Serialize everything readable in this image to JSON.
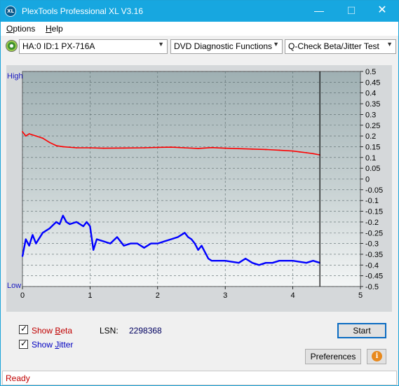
{
  "window": {
    "title": "PlexTools Professional XL V3.16",
    "app_icon_text": "XL",
    "minimize_glyph": "—",
    "maximize_glyph": "☐",
    "close_glyph": "✕"
  },
  "menu": {
    "options_first": "O",
    "options_rest": "ptions",
    "help_first": "H",
    "help_rest": "elp"
  },
  "toolbar": {
    "drive": "HA:0 ID:1  PX-716A",
    "function": "DVD Diagnostic Functions",
    "test": "Q-Check Beta/Jitter Test",
    "icons": [
      "drive-disc-icon",
      "chevron-down-icon"
    ]
  },
  "chart_data": {
    "type": "line",
    "left_axis_labels": {
      "high": "High",
      "low": "Low"
    },
    "right_axis_ticks": [
      "0.5",
      "0.45",
      "0.4",
      "0.35",
      "0.3",
      "0.25",
      "0.2",
      "0.15",
      "0.1",
      "0.05",
      "0",
      "-0.05",
      "-0.1",
      "-0.15",
      "-0.2",
      "-0.25",
      "-0.3",
      "-0.35",
      "-0.4",
      "-0.45",
      "-0.5"
    ],
    "y_range": [
      -0.5,
      0.5
    ],
    "x_ticks": [
      "0",
      "1",
      "2",
      "3",
      "4",
      "5"
    ],
    "x_range": [
      0,
      5
    ],
    "end_marker_x": 4.4,
    "grid": true,
    "series": [
      {
        "color": "#ff0000",
        "points": [
          [
            0.0,
            0.22
          ],
          [
            0.05,
            0.2
          ],
          [
            0.1,
            0.21
          ],
          [
            0.2,
            0.2
          ],
          [
            0.3,
            0.19
          ],
          [
            0.4,
            0.17
          ],
          [
            0.5,
            0.155
          ],
          [
            0.6,
            0.15
          ],
          [
            0.8,
            0.145
          ],
          [
            1.0,
            0.145
          ],
          [
            1.2,
            0.143
          ],
          [
            1.5,
            0.144
          ],
          [
            1.8,
            0.145
          ],
          [
            2.0,
            0.147
          ],
          [
            2.2,
            0.148
          ],
          [
            2.4,
            0.145
          ],
          [
            2.6,
            0.142
          ],
          [
            2.8,
            0.146
          ],
          [
            3.0,
            0.143
          ],
          [
            3.2,
            0.141
          ],
          [
            3.4,
            0.139
          ],
          [
            3.6,
            0.137
          ],
          [
            3.8,
            0.134
          ],
          [
            4.0,
            0.13
          ],
          [
            4.1,
            0.126
          ],
          [
            4.2,
            0.122
          ],
          [
            4.3,
            0.118
          ],
          [
            4.4,
            0.112
          ]
        ]
      },
      {
        "color": "#0000ff",
        "points": [
          [
            0.0,
            -0.36
          ],
          [
            0.05,
            -0.28
          ],
          [
            0.1,
            -0.31
          ],
          [
            0.15,
            -0.26
          ],
          [
            0.2,
            -0.3
          ],
          [
            0.3,
            -0.25
          ],
          [
            0.4,
            -0.23
          ],
          [
            0.5,
            -0.2
          ],
          [
            0.55,
            -0.21
          ],
          [
            0.6,
            -0.17
          ],
          [
            0.65,
            -0.2
          ],
          [
            0.7,
            -0.21
          ],
          [
            0.8,
            -0.2
          ],
          [
            0.9,
            -0.22
          ],
          [
            0.95,
            -0.2
          ],
          [
            1.0,
            -0.22
          ],
          [
            1.05,
            -0.33
          ],
          [
            1.1,
            -0.28
          ],
          [
            1.2,
            -0.29
          ],
          [
            1.3,
            -0.3
          ],
          [
            1.4,
            -0.27
          ],
          [
            1.5,
            -0.31
          ],
          [
            1.6,
            -0.3
          ],
          [
            1.7,
            -0.3
          ],
          [
            1.8,
            -0.32
          ],
          [
            1.9,
            -0.3
          ],
          [
            2.0,
            -0.3
          ],
          [
            2.1,
            -0.29
          ],
          [
            2.2,
            -0.28
          ],
          [
            2.3,
            -0.27
          ],
          [
            2.4,
            -0.25
          ],
          [
            2.45,
            -0.27
          ],
          [
            2.5,
            -0.28
          ],
          [
            2.55,
            -0.3
          ],
          [
            2.6,
            -0.33
          ],
          [
            2.65,
            -0.31
          ],
          [
            2.7,
            -0.34
          ],
          [
            2.75,
            -0.37
          ],
          [
            2.8,
            -0.38
          ],
          [
            3.0,
            -0.38
          ],
          [
            3.2,
            -0.39
          ],
          [
            3.3,
            -0.37
          ],
          [
            3.4,
            -0.39
          ],
          [
            3.5,
            -0.4
          ],
          [
            3.6,
            -0.39
          ],
          [
            3.7,
            -0.39
          ],
          [
            3.8,
            -0.38
          ],
          [
            3.9,
            -0.38
          ],
          [
            4.0,
            -0.38
          ],
          [
            4.2,
            -0.39
          ],
          [
            4.3,
            -0.38
          ],
          [
            4.4,
            -0.39
          ]
        ]
      }
    ]
  },
  "controls": {
    "show_beta_first": "Show ",
    "show_beta_u": "B",
    "show_beta_rest": "eta",
    "show_jitter_first": "Show ",
    "show_jitter_u": "J",
    "show_jitter_rest": "itter",
    "lsn_label": "LSN:",
    "lsn_value": "2298368",
    "start_label": "Start",
    "preferences_label": "Preferences",
    "info_glyph": "i"
  },
  "status": {
    "text": "Ready"
  }
}
